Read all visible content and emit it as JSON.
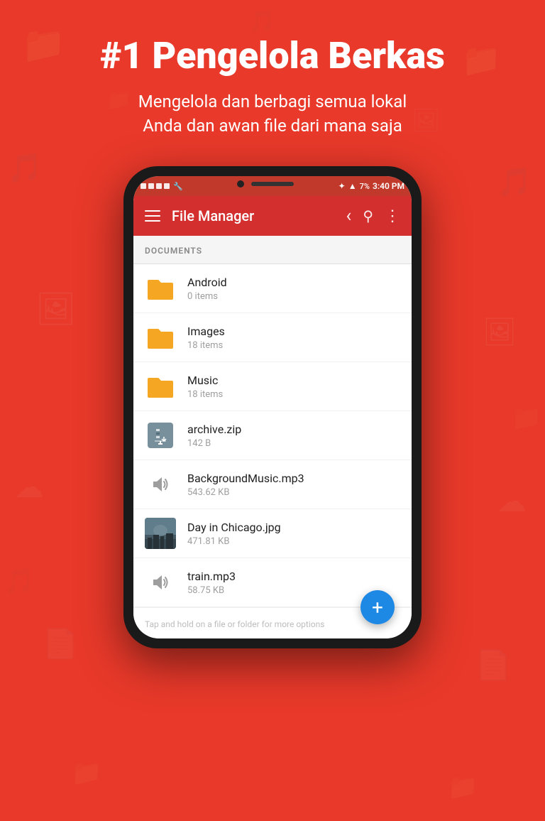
{
  "background": {
    "color": "#e8392a"
  },
  "header": {
    "title": "#1 Pengelola Berkas",
    "subtitle_line1": "Mengelola dan berbagi semua lokal",
    "subtitle_line2": "Anda dan awan file dari mana saja"
  },
  "phone": {
    "status_bar": {
      "battery": "7%",
      "time": "3:40 PM"
    },
    "app_bar": {
      "title": "File Manager"
    },
    "section_label": "DOCUMENTS",
    "files": [
      {
        "name": "Android",
        "meta": "0 items",
        "type": "folder"
      },
      {
        "name": "Images",
        "meta": "18 items",
        "type": "folder"
      },
      {
        "name": "Music",
        "meta": "18 items",
        "type": "folder"
      },
      {
        "name": "archive.zip",
        "meta": "142 B",
        "type": "archive"
      },
      {
        "name": "BackgroundMusic.mp3",
        "meta": "543.62 KB",
        "type": "audio"
      },
      {
        "name": "Day in Chicago.jpg",
        "meta": "471.81 KB",
        "type": "image"
      },
      {
        "name": "train.mp3",
        "meta": "58.75 KB",
        "type": "audio"
      }
    ],
    "hint": "Tap and hold on a file or folder for more options",
    "fab_label": "+"
  },
  "icons": {
    "hamburger": "☰",
    "back": "‹",
    "search": "🔍",
    "more": "⋮",
    "fab_plus": "+"
  }
}
